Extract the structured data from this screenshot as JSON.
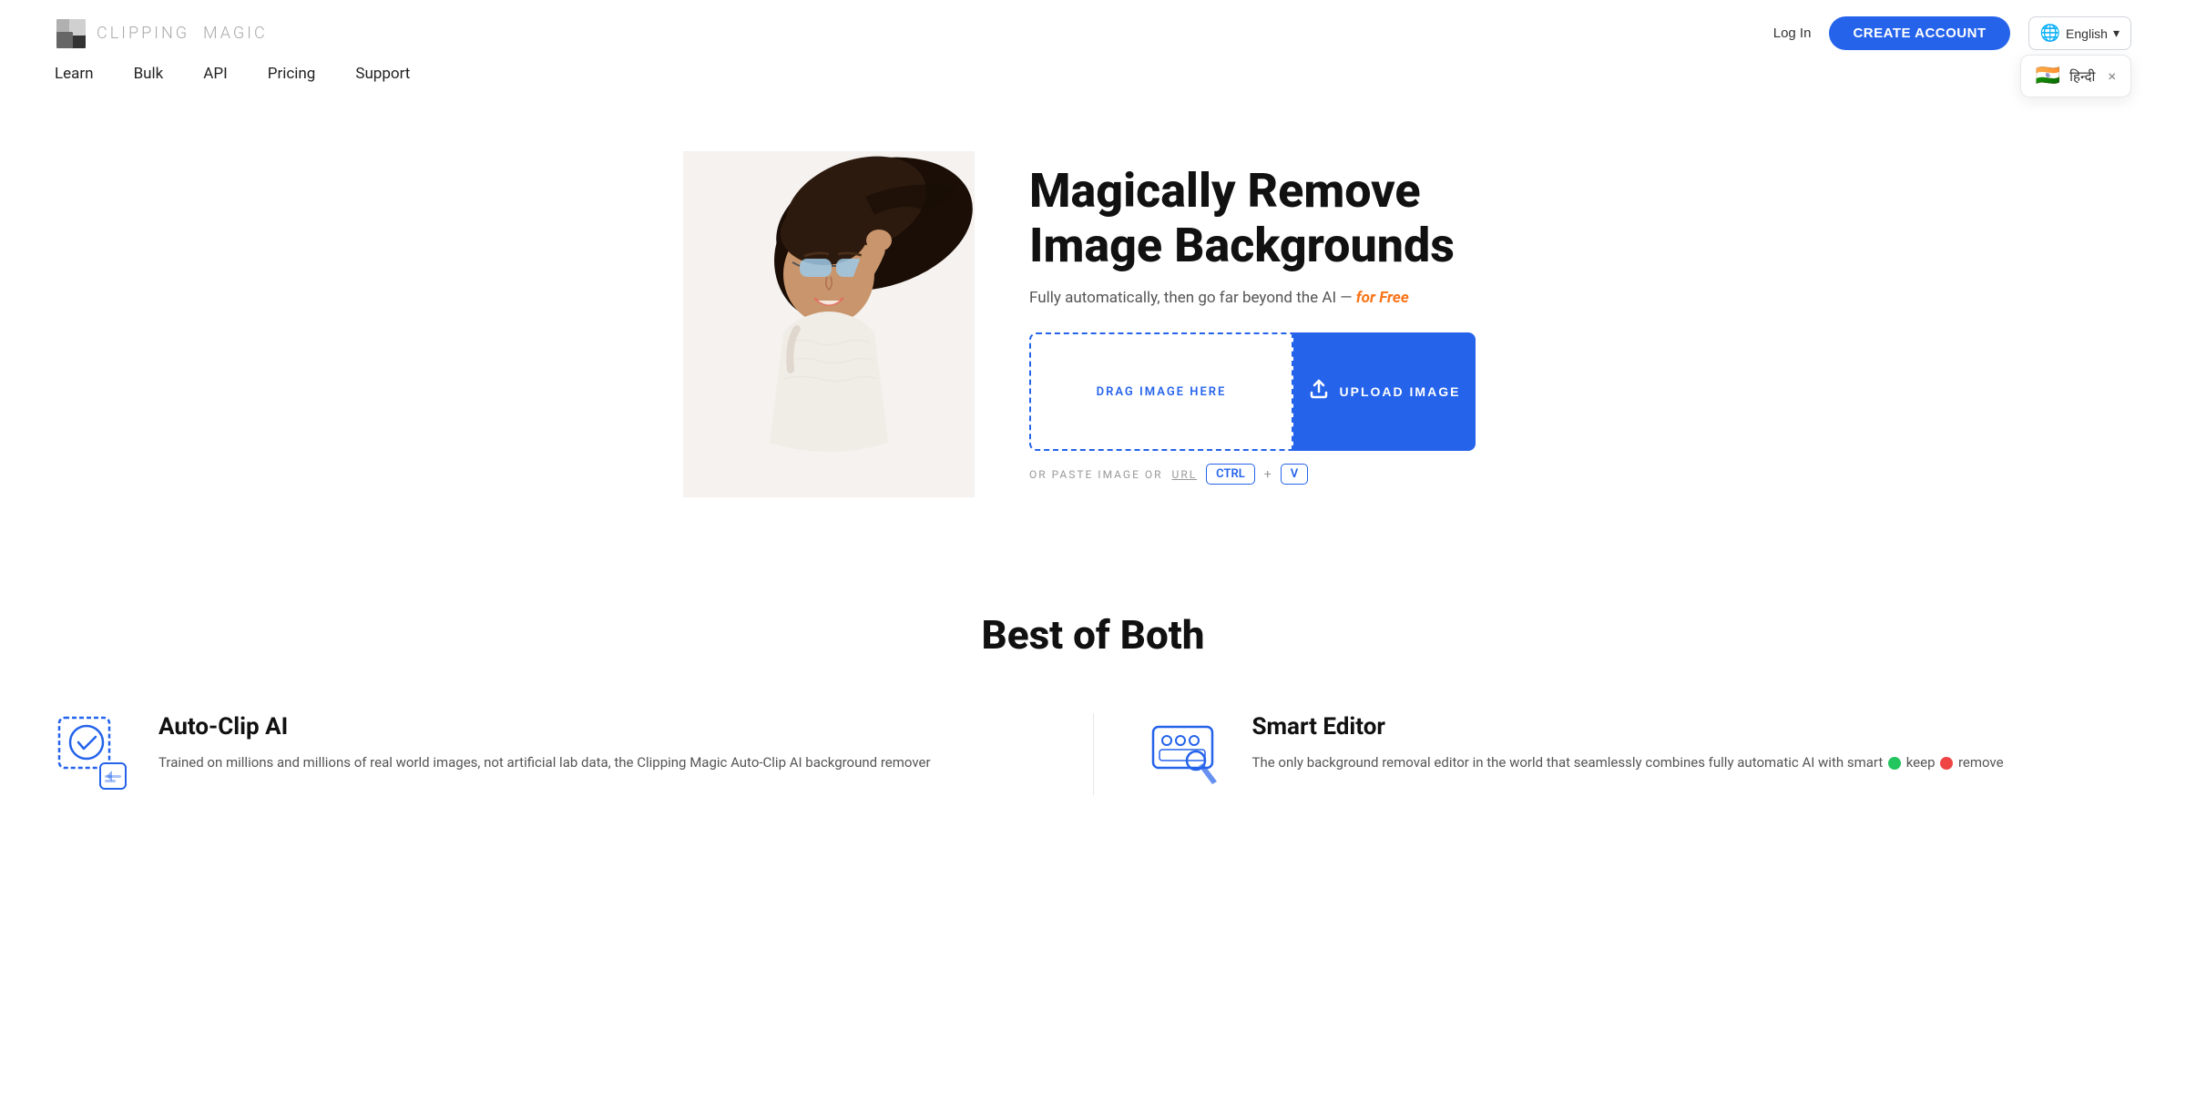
{
  "header": {
    "logo_text_main": "CLIPPING",
    "logo_text_sub": "MAGIC",
    "login_label": "Log In",
    "create_account_label": "CREATE ACCOUNT",
    "lang_label": "English",
    "lang_chevron": "▾",
    "lang_dropdown_flag": "🇮🇳",
    "lang_dropdown_name": "हिन्दी",
    "lang_dropdown_close": "×"
  },
  "nav": {
    "items": [
      {
        "label": "Learn",
        "href": "#"
      },
      {
        "label": "Bulk",
        "href": "#"
      },
      {
        "label": "API",
        "href": "#"
      },
      {
        "label": "Pricing",
        "href": "#"
      },
      {
        "label": "Support",
        "href": "#"
      }
    ]
  },
  "hero": {
    "title_line1": "Magically Remove",
    "title_line2": "Image Backgrounds",
    "subtitle_before": "Fully automatically, then go far beyond the AI —",
    "subtitle_highlight": " for Free",
    "drag_label": "DRAG IMAGE HERE",
    "upload_label": "UPLOAD IMAGE",
    "paste_before": "OR PASTE IMAGE OR",
    "paste_url_label": "URL",
    "ctrl_key": "CTRL",
    "plus": "+",
    "v_key": "V"
  },
  "best": {
    "title": "Best of Both"
  },
  "features": [
    {
      "title": "Auto-Clip AI",
      "description": "Trained on millions and millions of real world images, not artificial lab data, the Clipping Magic Auto-Clip AI background remover"
    },
    {
      "title": "Smart Editor",
      "description": "The only background removal editor in the world that seamlessly combines fully automatic AI with smart  keep  remove"
    }
  ],
  "colors": {
    "accent": "#2563eb",
    "orange": "#f97316",
    "text_dark": "#111111",
    "text_mid": "#555555",
    "border": "#e5e7eb"
  }
}
